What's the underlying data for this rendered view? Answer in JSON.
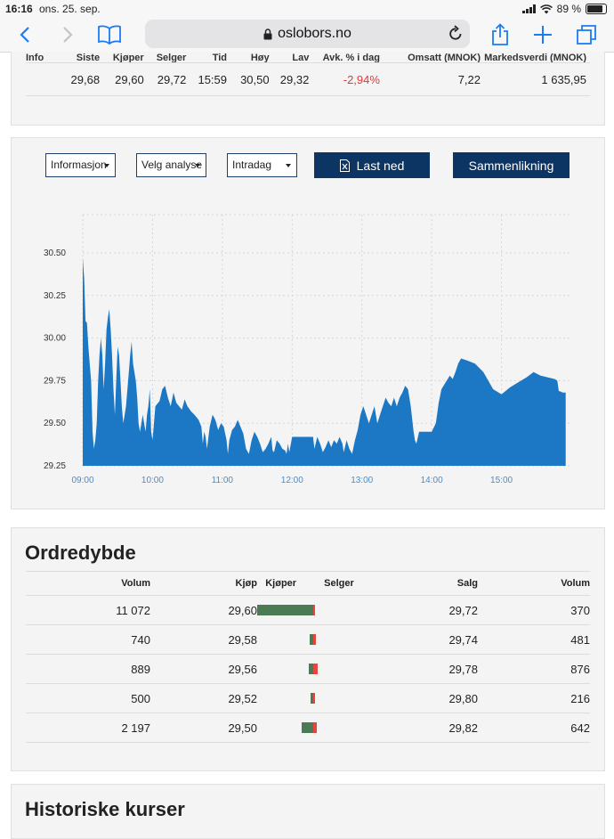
{
  "status": {
    "time": "16:16",
    "date": "ons. 25. sep.",
    "battery": "89 %"
  },
  "browser": {
    "url": "oslobors.no"
  },
  "quote": {
    "headers": [
      "Info",
      "Siste",
      "Kjøper",
      "Selger",
      "Tid",
      "Høy",
      "Lav",
      "Avk. % i dag",
      "Omsatt (MNOK)",
      "Markedsverdi (MNOK)"
    ],
    "values": [
      "",
      "29,68",
      "29,60",
      "29,72",
      "15:59",
      "30,50",
      "29,32",
      "-2,94%",
      "7,22",
      "1 635,95"
    ]
  },
  "controls": {
    "info_select": "Informasjon",
    "analysis_select": "Velg analyse",
    "period_select": "Intradag",
    "download_label": "Last ned",
    "compare_label": "Sammenlikning"
  },
  "chart_data": {
    "type": "area",
    "x_ticks": [
      "09:00",
      "10:00",
      "11:00",
      "12:00",
      "13:00",
      "14:00",
      "15:00"
    ],
    "y_ticks": [
      "30.50",
      "30.25",
      "30.00",
      "29.75",
      "29.50",
      "29.25"
    ],
    "ylim": [
      29.25,
      30.5
    ],
    "xlim_hours": [
      9.0,
      16.0
    ],
    "grid": true,
    "color": "#1c78c4",
    "points": [
      [
        9.0,
        30.47
      ],
      [
        9.02,
        30.35
      ],
      [
        9.04,
        30.1
      ],
      [
        9.06,
        30.09
      ],
      [
        9.08,
        29.95
      ],
      [
        9.1,
        29.85
      ],
      [
        9.12,
        29.75
      ],
      [
        9.14,
        29.45
      ],
      [
        9.16,
        29.35
      ],
      [
        9.18,
        29.4
      ],
      [
        9.2,
        29.5
      ],
      [
        9.22,
        29.75
      ],
      [
        9.24,
        29.9
      ],
      [
        9.26,
        30.0
      ],
      [
        9.28,
        29.9
      ],
      [
        9.3,
        29.7
      ],
      [
        9.32,
        29.85
      ],
      [
        9.34,
        30.05
      ],
      [
        9.36,
        30.12
      ],
      [
        9.38,
        30.17
      ],
      [
        9.4,
        30.05
      ],
      [
        9.42,
        29.9
      ],
      [
        9.44,
        29.7
      ],
      [
        9.46,
        29.55
      ],
      [
        9.48,
        29.75
      ],
      [
        9.5,
        29.95
      ],
      [
        9.52,
        29.9
      ],
      [
        9.54,
        29.75
      ],
      [
        9.56,
        29.6
      ],
      [
        9.58,
        29.5
      ],
      [
        9.6,
        29.55
      ],
      [
        9.62,
        29.6
      ],
      [
        9.64,
        29.7
      ],
      [
        9.66,
        29.8
      ],
      [
        9.68,
        29.9
      ],
      [
        9.7,
        29.98
      ],
      [
        9.72,
        29.85
      ],
      [
        9.74,
        29.8
      ],
      [
        9.76,
        29.75
      ],
      [
        9.78,
        29.65
      ],
      [
        9.8,
        29.5
      ],
      [
        9.82,
        29.45
      ],
      [
        9.84,
        29.5
      ],
      [
        9.86,
        29.55
      ],
      [
        9.88,
        29.5
      ],
      [
        9.9,
        29.45
      ],
      [
        9.92,
        29.55
      ],
      [
        9.94,
        29.6
      ],
      [
        9.96,
        29.7
      ],
      [
        9.98,
        29.45
      ],
      [
        10.0,
        29.4
      ],
      [
        10.04,
        29.6
      ],
      [
        10.1,
        29.63
      ],
      [
        10.14,
        29.7
      ],
      [
        10.18,
        29.72
      ],
      [
        10.22,
        29.65
      ],
      [
        10.26,
        29.6
      ],
      [
        10.3,
        29.68
      ],
      [
        10.34,
        29.62
      ],
      [
        10.38,
        29.6
      ],
      [
        10.42,
        29.58
      ],
      [
        10.46,
        29.64
      ],
      [
        10.5,
        29.6
      ],
      [
        10.55,
        29.57
      ],
      [
        10.6,
        29.55
      ],
      [
        10.66,
        29.52
      ],
      [
        10.7,
        29.48
      ],
      [
        10.72,
        29.38
      ],
      [
        10.74,
        29.45
      ],
      [
        10.76,
        29.42
      ],
      [
        10.78,
        29.35
      ],
      [
        10.82,
        29.48
      ],
      [
        10.86,
        29.55
      ],
      [
        10.9,
        29.52
      ],
      [
        10.94,
        29.46
      ],
      [
        10.98,
        29.5
      ],
      [
        11.02,
        29.48
      ],
      [
        11.06,
        29.4
      ],
      [
        11.08,
        29.32
      ],
      [
        11.1,
        29.4
      ],
      [
        11.14,
        29.46
      ],
      [
        11.18,
        29.48
      ],
      [
        11.22,
        29.52
      ],
      [
        11.26,
        29.48
      ],
      [
        11.3,
        29.44
      ],
      [
        11.34,
        29.35
      ],
      [
        11.38,
        29.32
      ],
      [
        11.42,
        29.4
      ],
      [
        11.46,
        29.45
      ],
      [
        11.5,
        29.42
      ],
      [
        11.54,
        29.38
      ],
      [
        11.58,
        29.33
      ],
      [
        11.62,
        29.35
      ],
      [
        11.66,
        29.38
      ],
      [
        11.7,
        29.42
      ],
      [
        11.72,
        29.34
      ],
      [
        11.74,
        29.33
      ],
      [
        11.78,
        29.4
      ],
      [
        11.82,
        29.38
      ],
      [
        11.86,
        29.35
      ],
      [
        11.9,
        29.34
      ],
      [
        11.92,
        29.32
      ],
      [
        11.94,
        29.38
      ],
      [
        11.96,
        29.33
      ],
      [
        12.0,
        29.42
      ],
      [
        12.1,
        29.42
      ],
      [
        12.2,
        29.42
      ],
      [
        12.3,
        29.42
      ],
      [
        12.32,
        29.35
      ],
      [
        12.36,
        29.42
      ],
      [
        12.4,
        29.38
      ],
      [
        12.44,
        29.33
      ],
      [
        12.48,
        29.36
      ],
      [
        12.52,
        29.4
      ],
      [
        12.56,
        29.36
      ],
      [
        12.6,
        29.4
      ],
      [
        12.64,
        29.38
      ],
      [
        12.68,
        29.42
      ],
      [
        12.72,
        29.38
      ],
      [
        12.74,
        29.33
      ],
      [
        12.78,
        29.4
      ],
      [
        12.82,
        29.35
      ],
      [
        12.86,
        29.32
      ],
      [
        12.9,
        29.4
      ],
      [
        12.94,
        29.46
      ],
      [
        12.98,
        29.55
      ],
      [
        13.02,
        29.6
      ],
      [
        13.06,
        29.55
      ],
      [
        13.1,
        29.5
      ],
      [
        13.14,
        29.55
      ],
      [
        13.18,
        29.6
      ],
      [
        13.22,
        29.5
      ],
      [
        13.26,
        29.55
      ],
      [
        13.3,
        29.6
      ],
      [
        13.34,
        29.65
      ],
      [
        13.38,
        29.62
      ],
      [
        13.42,
        29.6
      ],
      [
        13.46,
        29.65
      ],
      [
        13.5,
        29.6
      ],
      [
        13.54,
        29.65
      ],
      [
        13.58,
        29.68
      ],
      [
        13.62,
        29.72
      ],
      [
        13.66,
        29.7
      ],
      [
        13.7,
        29.6
      ],
      [
        13.74,
        29.45
      ],
      [
        13.76,
        29.4
      ],
      [
        13.78,
        29.38
      ],
      [
        13.82,
        29.45
      ],
      [
        13.9,
        29.45
      ],
      [
        14.0,
        29.45
      ],
      [
        14.06,
        29.5
      ],
      [
        14.1,
        29.62
      ],
      [
        14.14,
        29.7
      ],
      [
        14.2,
        29.74
      ],
      [
        14.26,
        29.78
      ],
      [
        14.3,
        29.76
      ],
      [
        14.34,
        29.8
      ],
      [
        14.38,
        29.85
      ],
      [
        14.42,
        29.88
      ],
      [
        14.5,
        29.87
      ],
      [
        14.62,
        29.85
      ],
      [
        14.74,
        29.8
      ],
      [
        14.88,
        29.7
      ],
      [
        15.0,
        29.67
      ],
      [
        15.12,
        29.71
      ],
      [
        15.24,
        29.74
      ],
      [
        15.36,
        29.77
      ],
      [
        15.46,
        29.8
      ],
      [
        15.56,
        29.78
      ],
      [
        15.66,
        29.77
      ],
      [
        15.76,
        29.76
      ],
      [
        15.8,
        29.75
      ],
      [
        15.82,
        29.69
      ],
      [
        15.88,
        29.68
      ],
      [
        15.92,
        29.68
      ]
    ]
  },
  "orderbook": {
    "title": "Ordredybde",
    "headers": {
      "bid_volume": "Volum",
      "bid": "Kjøp",
      "buyer": "Kjøper",
      "seller": "Selger",
      "ask": "Salg",
      "ask_volume": "Volum"
    },
    "rows": [
      {
        "bid_volume": "11 072",
        "bid": "29,60",
        "ask": "29,72",
        "ask_volume": "370",
        "buy_frac": 1.0,
        "sell_frac": 0.03
      },
      {
        "bid_volume": "740",
        "bid": "29,58",
        "ask": "29,74",
        "ask_volume": "481",
        "buy_frac": 0.07,
        "sell_frac": 0.04
      },
      {
        "bid_volume": "889",
        "bid": "29,56",
        "ask": "29,78",
        "ask_volume": "876",
        "buy_frac": 0.08,
        "sell_frac": 0.08
      },
      {
        "bid_volume": "500",
        "bid": "29,52",
        "ask": "29,80",
        "ask_volume": "216",
        "buy_frac": 0.05,
        "sell_frac": 0.02
      },
      {
        "bid_volume": "2 197",
        "bid": "29,50",
        "ask": "29,82",
        "ask_volume": "642",
        "buy_frac": 0.2,
        "sell_frac": 0.06
      }
    ]
  },
  "history": {
    "title": "Historiske kurser"
  }
}
